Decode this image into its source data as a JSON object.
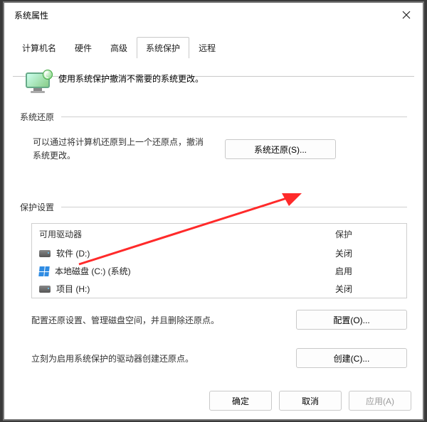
{
  "title": "系统属性",
  "tabs": [
    "计算机名",
    "硬件",
    "高级",
    "系统保护",
    "远程"
  ],
  "active_tab_index": 3,
  "intro": "使用系统保护撤消不需要的系统更改。",
  "groups": {
    "restore": {
      "title": "系统还原",
      "text": "可以通过将计算机还原到上一个还原点，撤消系统更改。",
      "button": "系统还原(S)..."
    },
    "protect": {
      "title": "保护设置",
      "headers": {
        "drive": "可用驱动器",
        "status": "保护"
      },
      "rows": [
        {
          "icon": "hdd",
          "name": "软件 (D:)",
          "status": "关闭"
        },
        {
          "icon": "win",
          "name": "本地磁盘 (C:) (系统)",
          "status": "启用"
        },
        {
          "icon": "hdd",
          "name": "项目 (H:)",
          "status": "关闭"
        }
      ],
      "configure_text": "配置还原设置、管理磁盘空间，并且删除还原点。",
      "configure_btn": "配置(O)...",
      "create_text": "立刻为启用系统保护的驱动器创建还原点。",
      "create_btn": "创建(C)..."
    }
  },
  "footer": {
    "ok": "确定",
    "cancel": "取消",
    "apply": "应用(A)"
  }
}
